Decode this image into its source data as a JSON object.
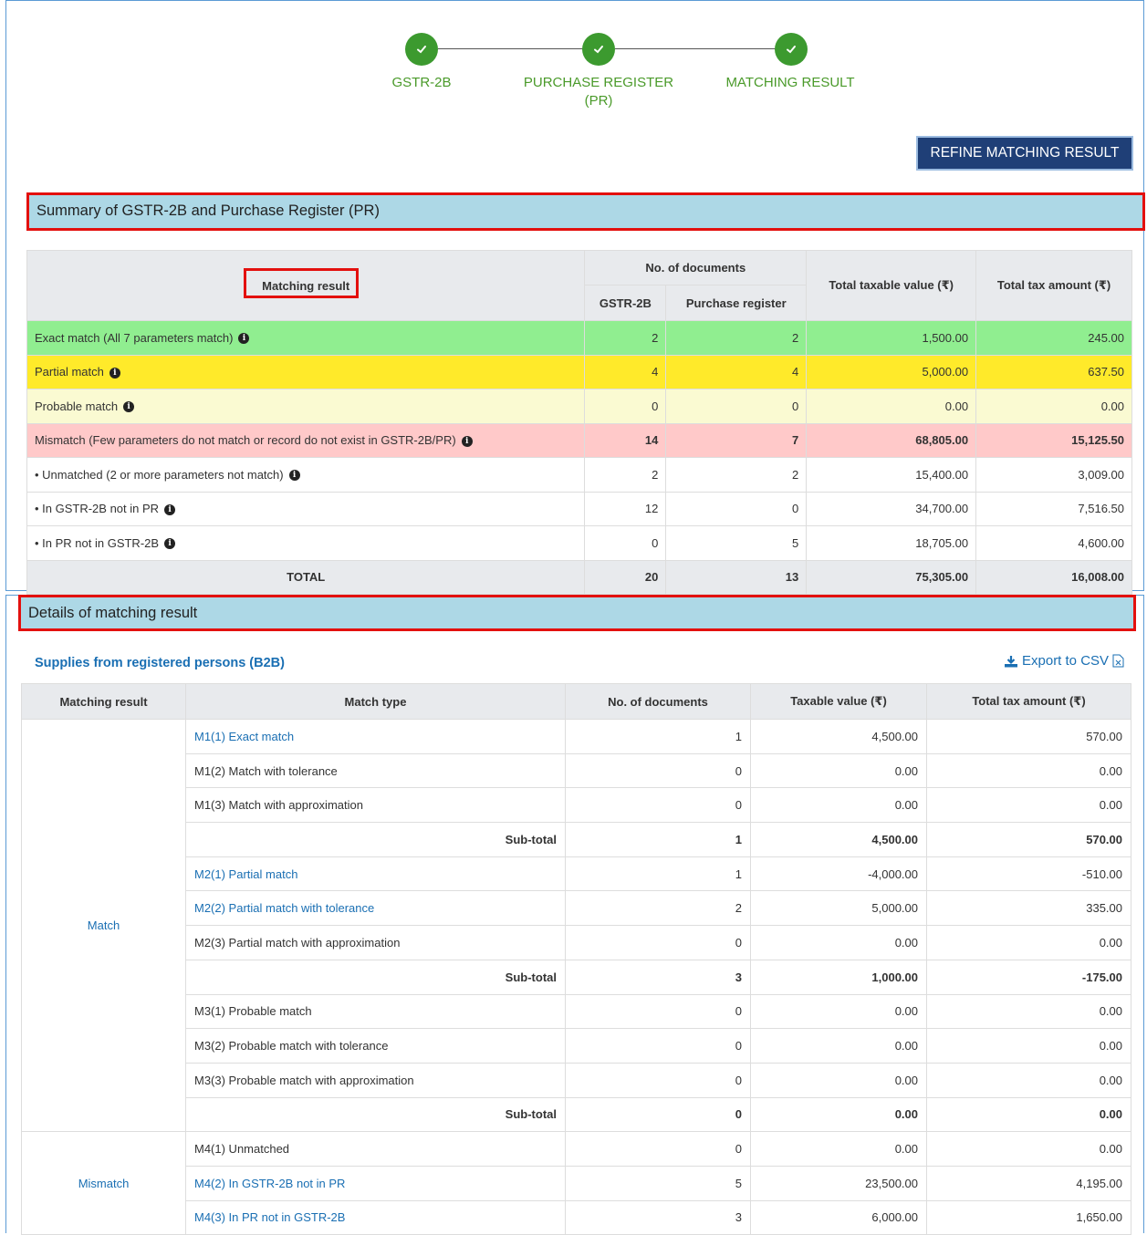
{
  "stepper": {
    "steps": [
      {
        "label": "GSTR-2B"
      },
      {
        "label": "PURCHASE REGISTER (PR)"
      },
      {
        "label": "MATCHING RESULT"
      }
    ]
  },
  "refine_button": "REFINE MATCHING RESULT",
  "summary": {
    "title": "Summary of GSTR-2B and Purchase Register (PR)",
    "headers": {
      "matching_result": "Matching result",
      "no_docs": "No. of documents",
      "gstr2b": "GSTR-2B",
      "pr": "Purchase register",
      "taxable": "Total taxable value (₹)",
      "tax": "Total tax amount (₹)"
    },
    "rows": [
      {
        "label": "Exact match (All 7 parameters match)",
        "gstr2b": "2",
        "pr": "2",
        "taxable": "1,500.00",
        "tax": "245.00"
      },
      {
        "label": "Partial match",
        "gstr2b": "4",
        "pr": "4",
        "taxable": "5,000.00",
        "tax": "637.50"
      },
      {
        "label": "Probable match",
        "gstr2b": "0",
        "pr": "0",
        "taxable": "0.00",
        "tax": "0.00"
      },
      {
        "label": "Mismatch (Few parameters do not match or record do not exist in GSTR-2B/PR)",
        "gstr2b": "14",
        "pr": "7",
        "taxable": "68,805.00",
        "tax": "15,125.50"
      },
      {
        "label": "• Unmatched (2 or more parameters not match)",
        "gstr2b": "2",
        "pr": "2",
        "taxable": "15,400.00",
        "tax": "3,009.00"
      },
      {
        "label": "• In GSTR-2B not in PR",
        "gstr2b": "12",
        "pr": "0",
        "taxable": "34,700.00",
        "tax": "7,516.50"
      },
      {
        "label": "• In PR not in GSTR-2B",
        "gstr2b": "0",
        "pr": "5",
        "taxable": "18,705.00",
        "tax": "4,600.00"
      }
    ],
    "total": {
      "label": "TOTAL",
      "gstr2b": "20",
      "pr": "13",
      "taxable": "75,305.00",
      "tax": "16,008.00"
    }
  },
  "details": {
    "title": "Details of matching result",
    "b2b_title": "Supplies from registered persons (B2B)",
    "export_label": "Export to CSV",
    "headers": {
      "matching_result": "Matching result",
      "match_type": "Match type",
      "no_docs": "No. of documents",
      "taxable": "Taxable value (₹)",
      "tax": "Total tax amount (₹)"
    },
    "group_match": "Match",
    "group_mismatch": "Mismatch",
    "rows": [
      {
        "type": "M1(1) Exact match",
        "docs": "1",
        "taxable": "4,500.00",
        "tax": "570.00"
      },
      {
        "type": "M1(2) Match with tolerance",
        "docs": "0",
        "taxable": "0.00",
        "tax": "0.00"
      },
      {
        "type": "M1(3) Match with approximation",
        "docs": "0",
        "taxable": "0.00",
        "tax": "0.00"
      },
      {
        "type": "Sub-total",
        "docs": "1",
        "taxable": "4,500.00",
        "tax": "570.00"
      },
      {
        "type": "M2(1) Partial match",
        "docs": "1",
        "taxable": "-4,000.00",
        "tax": "-510.00"
      },
      {
        "type": "M2(2) Partial match with tolerance",
        "docs": "2",
        "taxable": "5,000.00",
        "tax": "335.00"
      },
      {
        "type": "M2(3) Partial match with approximation",
        "docs": "0",
        "taxable": "0.00",
        "tax": "0.00"
      },
      {
        "type": "Sub-total",
        "docs": "3",
        "taxable": "1,000.00",
        "tax": "-175.00"
      },
      {
        "type": "M3(1) Probable match",
        "docs": "0",
        "taxable": "0.00",
        "tax": "0.00"
      },
      {
        "type": "M3(2) Probable match with tolerance",
        "docs": "0",
        "taxable": "0.00",
        "tax": "0.00"
      },
      {
        "type": "M3(3) Probable match with approximation",
        "docs": "0",
        "taxable": "0.00",
        "tax": "0.00"
      },
      {
        "type": "Sub-total",
        "docs": "0",
        "taxable": "0.00",
        "tax": "0.00"
      },
      {
        "type": "M4(1) Unmatched",
        "docs": "0",
        "taxable": "0.00",
        "tax": "0.00"
      },
      {
        "type": "M4(2) In GSTR-2B not in PR",
        "docs": "5",
        "taxable": "23,500.00",
        "tax": "4,195.00"
      },
      {
        "type": "M4(3) In PR not in GSTR-2B",
        "docs": "3",
        "taxable": "6,000.00",
        "tax": "1,650.00"
      }
    ]
  },
  "colors": {
    "exact": "#90ee90",
    "partial": "#ffea2a",
    "probable": "#fafad2",
    "mismatch": "#ffc9c9",
    "section_bar": "#add8e6",
    "link": "#1a6fb3",
    "step": "#3c9a2f",
    "button": "#1f3f77",
    "highlight": "#e3100e"
  },
  "icons": [
    "check-icon",
    "info-icon",
    "download-icon",
    "csv-file-icon"
  ]
}
